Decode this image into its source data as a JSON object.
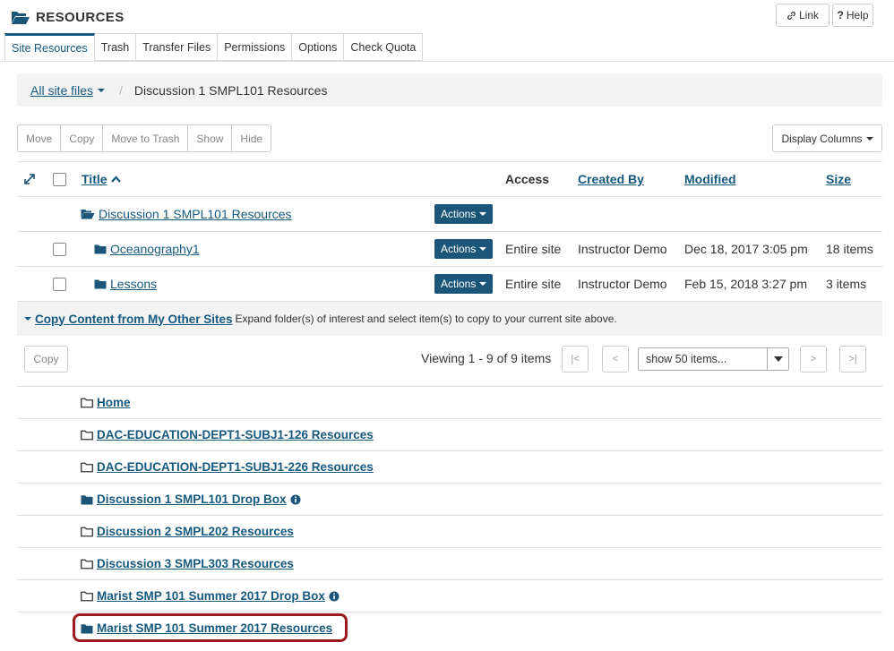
{
  "header": {
    "title": "RESOURCES",
    "link_label": "Link",
    "help_label": "Help"
  },
  "tabs": [
    "Site Resources",
    "Trash",
    "Transfer Files",
    "Permissions",
    "Options",
    "Check Quota"
  ],
  "breadcrumb": {
    "root": "All site files",
    "separator": "/",
    "current": "Discussion 1 SMPL101 Resources"
  },
  "toolbar": {
    "buttons": [
      "Move",
      "Copy",
      "Move to Trash",
      "Show",
      "Hide"
    ],
    "display_columns": "Display Columns"
  },
  "table": {
    "headers": {
      "title": "Title",
      "access": "Access",
      "created_by": "Created By",
      "modified": "Modified",
      "size": "Size"
    },
    "parent": {
      "title": "Discussion 1 SMPL101 Resources",
      "actions": "Actions"
    },
    "rows": [
      {
        "title": "Oceanography1",
        "actions": "Actions",
        "access": "Entire site",
        "created_by": "Instructor Demo",
        "modified": "Dec 18, 2017 3:05 pm",
        "size": "18 items"
      },
      {
        "title": "Lessons",
        "actions": "Actions",
        "access": "Entire site",
        "created_by": "Instructor Demo",
        "modified": "Feb 15, 2018 3:27 pm",
        "size": "3 items"
      }
    ]
  },
  "copy_content": {
    "title": "Copy Content from My Other Sites",
    "hint": "Expand folder(s) of interest and select item(s) to copy to your current site above.",
    "copy_button": "Copy",
    "viewing": "Viewing 1 - 9 of 9 items",
    "pager": {
      "first": "|<",
      "prev": "<",
      "next": ">",
      "last": ">|"
    },
    "page_size": "show 50 items...",
    "sites": [
      {
        "name": "Home",
        "icon": "folder-open-icon",
        "info": false
      },
      {
        "name": "DAC-EDUCATION-DEPT1-SUBJ1-126 Resources",
        "icon": "folder-open-icon",
        "info": false
      },
      {
        "name": "DAC-EDUCATION-DEPT1-SUBJ1-226 Resources",
        "icon": "folder-open-icon",
        "info": false
      },
      {
        "name": "Discussion 1 SMPL101 Drop Box",
        "icon": "folder-solid-icon",
        "info": true
      },
      {
        "name": "Discussion 2 SMPL202 Resources",
        "icon": "folder-open-icon",
        "info": false
      },
      {
        "name": "Discussion 3 SMPL303 Resources",
        "icon": "folder-open-icon",
        "info": false
      },
      {
        "name": "Marist SMP 101 Summer 2017 Drop Box",
        "icon": "folder-open-icon",
        "info": true
      },
      {
        "name": "Marist SMP 101 Summer 2017 Resources",
        "icon": "folder-solid-icon",
        "info": false
      }
    ]
  },
  "colors": {
    "link": "#15597e",
    "action_button": "#1b5679",
    "highlight": "#9b1b1e"
  }
}
